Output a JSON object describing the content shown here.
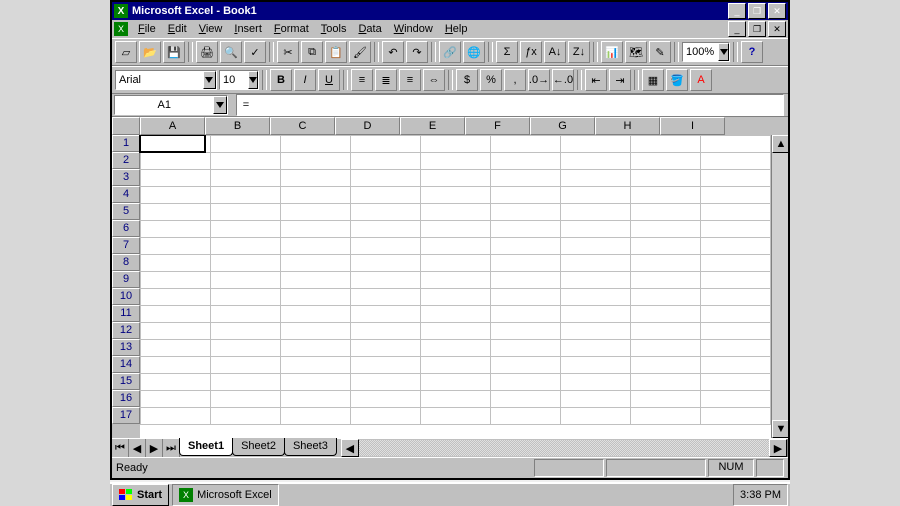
{
  "title": "Microsoft Excel - Book1",
  "menus": [
    "File",
    "Edit",
    "View",
    "Insert",
    "Format",
    "Tools",
    "Data",
    "Window",
    "Help"
  ],
  "toolbar1": {
    "zoom": "100%",
    "buttons": [
      "new",
      "open",
      "save",
      "print",
      "preview",
      "spell",
      "cut",
      "copy",
      "paste",
      "fmt-painter",
      "undo",
      "redo",
      "hyperlink",
      "web",
      "autosum",
      "function",
      "sort-asc",
      "sort-desc",
      "chart",
      "map",
      "drawing"
    ],
    "help": "?"
  },
  "toolbar2": {
    "font": "Arial",
    "size": "10",
    "buttons": [
      "bold",
      "italic",
      "underline",
      "align-left",
      "align-center",
      "align-right",
      "merge-center",
      "currency",
      "percent",
      "comma",
      "inc-dec",
      "dec-dec",
      "dec-indent",
      "inc-indent",
      "borders",
      "fill-color",
      "font-color"
    ]
  },
  "namebox": "A1",
  "formula_label": "=",
  "formula": "",
  "columns": [
    "A",
    "B",
    "C",
    "D",
    "E",
    "F",
    "G",
    "H",
    "I"
  ],
  "rows": 17,
  "active_cell": {
    "row": 1,
    "col": 1
  },
  "sheet_tabs": [
    "Sheet1",
    "Sheet2",
    "Sheet3"
  ],
  "active_sheet": 0,
  "status": {
    "ready": "Ready",
    "num": "NUM"
  },
  "taskbar": {
    "start": "Start",
    "app": "Microsoft Excel",
    "time": "3:38 PM"
  }
}
